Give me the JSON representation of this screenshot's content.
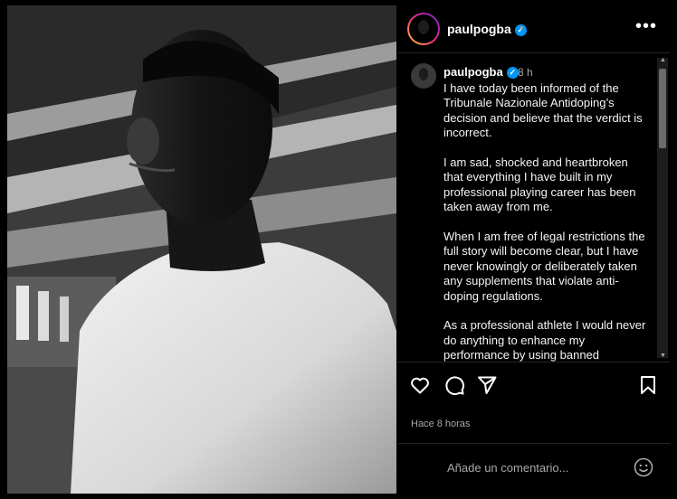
{
  "post": {
    "username": "paulpogba",
    "verified_badge": "✓",
    "header_separator": "•",
    "more_icon": "more-options-icon",
    "time_short": "8 h",
    "caption_paragraphs": [
      "I have today been informed of the Tribunale Nazionale Antidoping’s decision and believe that the verdict is incorrect.",
      "I am sad, shocked and heartbroken that everything I have built in my professional playing career has been taken away from me.",
      "When I am free of legal restrictions the full story will become clear, but I have never knowingly or deliberately taken any supplements that violate anti-doping regulations.",
      "As a professional athlete I would never do anything to enhance my performance by using banned substances and have"
    ],
    "time_ago": "Hace 8 horas",
    "comment_placeholder": "Añade un comentario...",
    "accent_color": "#0095f6"
  },
  "icons": [
    "heart-icon",
    "comment-icon",
    "share-icon",
    "bookmark-icon",
    "emoji-icon"
  ]
}
